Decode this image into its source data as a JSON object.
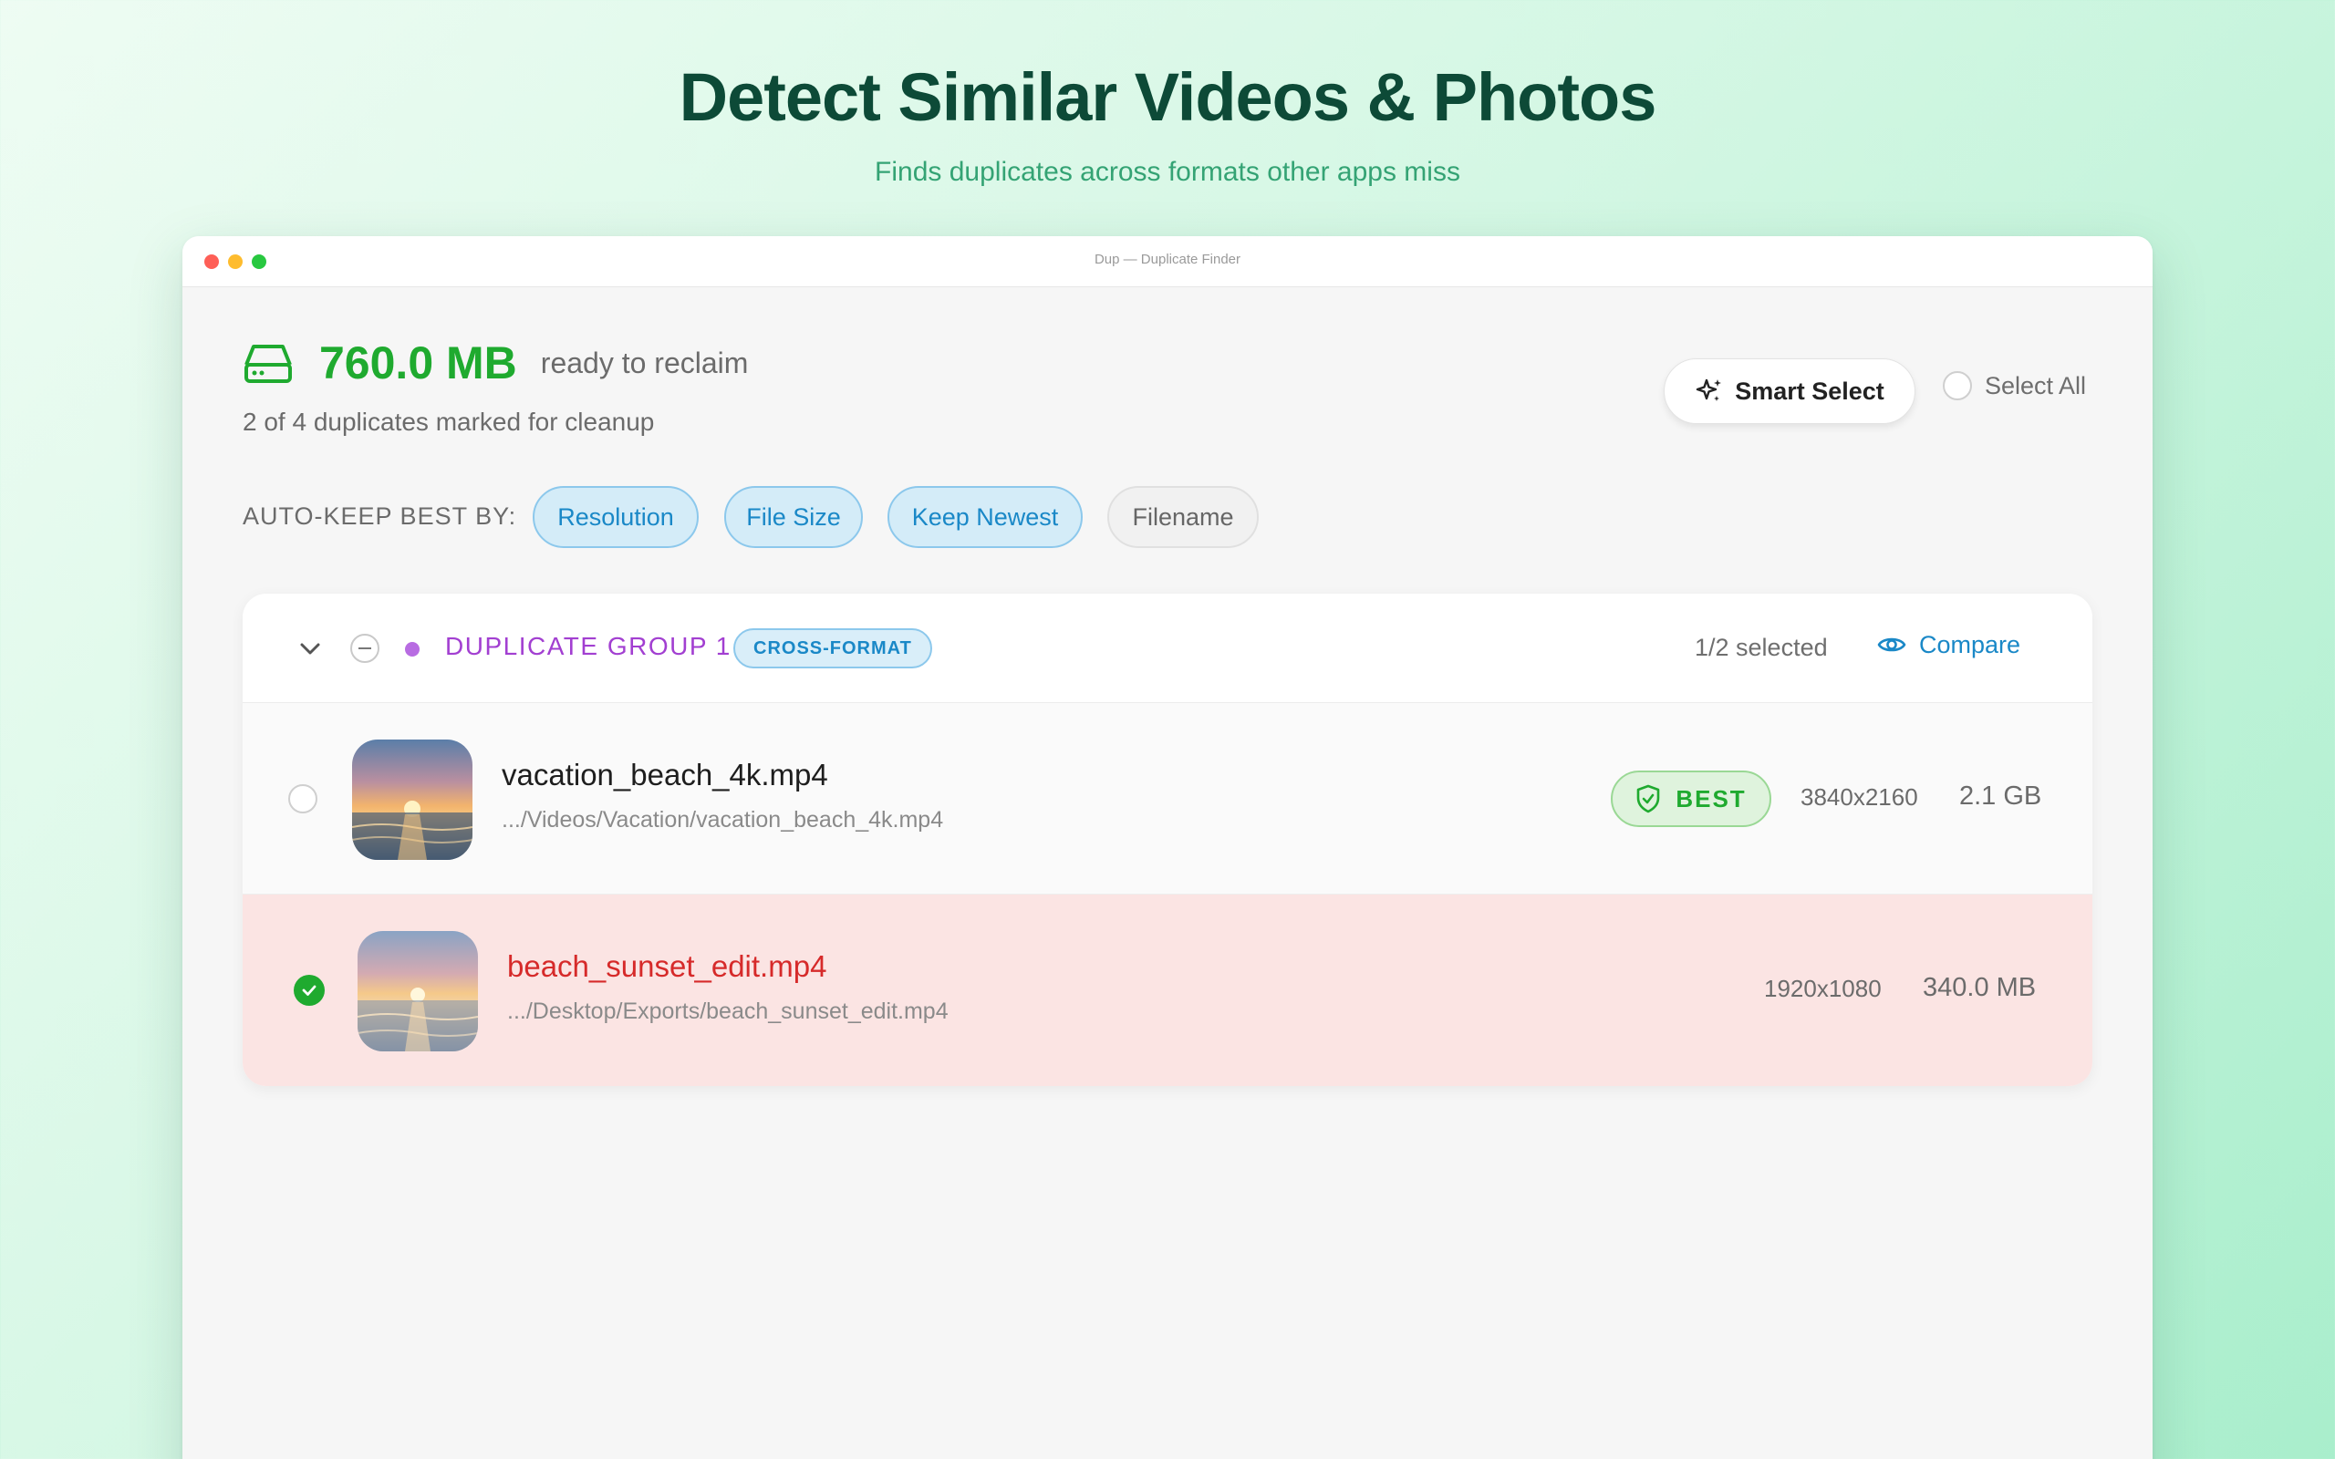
{
  "hero": {
    "title": "Detect Similar Videos & Photos",
    "subtitle": "Finds duplicates across formats other apps miss"
  },
  "window": {
    "title": "Dup — Duplicate Finder"
  },
  "summary": {
    "icon": "hard-drive-icon",
    "reclaim_size": "760.0 MB",
    "reclaim_label": "ready to reclaim",
    "marked_text": "2 of 4 duplicates marked for cleanup"
  },
  "toolbar": {
    "smart_select_label": "Smart Select",
    "smart_select_icon": "sparkles-icon",
    "select_all_label": "Select All"
  },
  "auto_keep": {
    "label": "AUTO-KEEP BEST BY:",
    "options": [
      {
        "label": "Resolution",
        "active": true
      },
      {
        "label": "File Size",
        "active": true
      },
      {
        "label": "Keep Newest",
        "active": true
      },
      {
        "label": "Filename",
        "active": false
      }
    ]
  },
  "group": {
    "title": "DUPLICATE GROUP 1",
    "badge": "CROSS-FORMAT",
    "selected_count": "1/2 selected",
    "compare_label": "Compare",
    "files": [
      {
        "name": "vacation_beach_4k.mp4",
        "path": ".../Videos/Vacation/vacation_beach_4k.mp4",
        "badge": "BEST",
        "resolution": "3840x2160",
        "size": "2.1 GB",
        "selected": false
      },
      {
        "name": "beach_sunset_edit.mp4",
        "path": ".../Desktop/Exports/beach_sunset_edit.mp4",
        "resolution": "1920x1080",
        "size": "340.0 MB",
        "selected": true
      }
    ]
  },
  "colors": {
    "accent_green": "#1faa2f",
    "accent_blue": "#1a88c7",
    "group_purple": "#a23fd1",
    "selected_row_bg": "#fbe4e3",
    "selected_text": "#d62a2a"
  }
}
